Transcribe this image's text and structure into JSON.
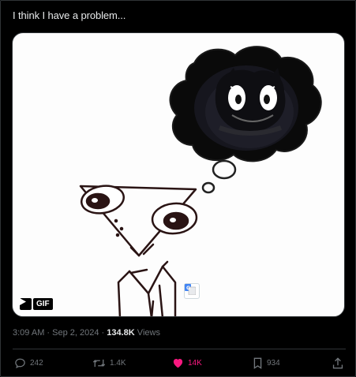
{
  "tweet": {
    "text": "I think I have a problem..."
  },
  "media": {
    "gif_label": "GIF"
  },
  "meta": {
    "time": "3:09 AM",
    "separator1": " · ",
    "date": "Sep 2, 2024",
    "separator2": " · ",
    "views_count": "134.8K",
    "views_label": " Views"
  },
  "actions": {
    "replies": "242",
    "reposts": "1.4K",
    "likes": "14K",
    "bookmarks": "934"
  },
  "colors": {
    "like": "#f91880",
    "muted": "#71767b",
    "text": "#e7e9ea"
  }
}
